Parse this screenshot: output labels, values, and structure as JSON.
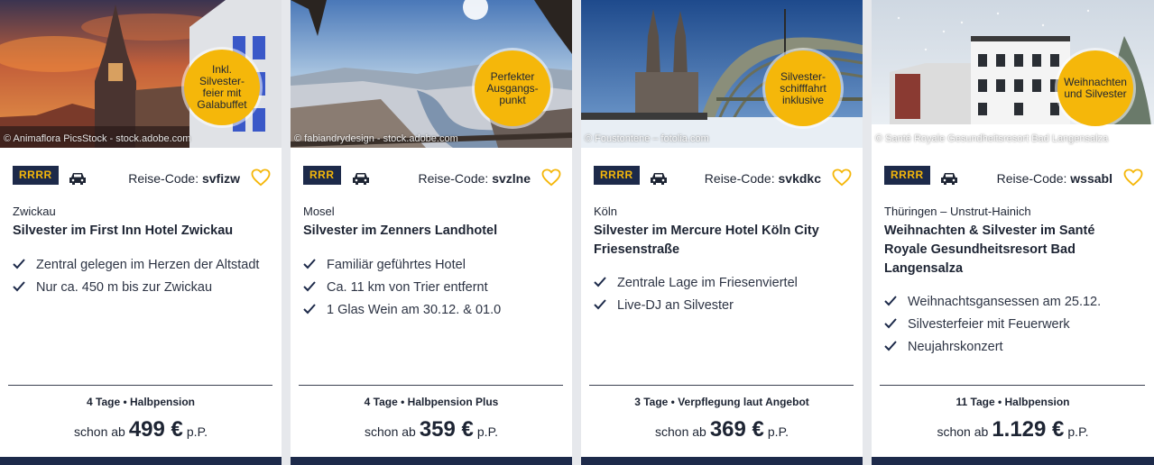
{
  "labels": {
    "code_prefix": "Reise-Code:",
    "price_prefix": "schon ab",
    "price_suffix": "p.P."
  },
  "colors": {
    "navy": "#1d2a4a",
    "accent_yellow": "#f5b70a"
  },
  "cards": [
    {
      "image_credit": "© Animaflora PicsStock - stock.adobe.com",
      "badge": "Inkl. Silvester-feier mit Galabuffet",
      "category": "RRRR",
      "transport_icon": "car-icon",
      "code": "svfizw",
      "region": "Zwickau",
      "title": "Silvester im First Inn Hotel Zwickau",
      "features": [
        "Zentral gelegen im Herzen der Altstadt",
        "Nur ca. 450 m bis zur Zwickau"
      ],
      "duration": "4 Tage • Halbpension",
      "price": "499 €"
    },
    {
      "image_credit": "© fabiandrydesign - stock.adobe.com",
      "badge": "Perfekter Ausgangs-punkt",
      "category": "RRR",
      "transport_icon": "car-icon",
      "code": "svzlne",
      "region": "Mosel",
      "title": "Silvester im Zenners Landhotel",
      "features": [
        "Familiär geführtes Hotel",
        "Ca. 11 km von Trier entfernt",
        "1 Glas Wein am 30.12. & 01.0"
      ],
      "duration": "4 Tage • Halbpension Plus",
      "price": "359 €"
    },
    {
      "image_credit": "© Foustontene – fotolia.com",
      "badge": "Silvester-schifffahrt inklusive",
      "category": "RRRR",
      "transport_icon": "car-icon",
      "code": "svkdkc",
      "region": "Köln",
      "title": "Silvester im Mercure Hotel Köln City Friesenstraße",
      "features": [
        "Zentrale Lage im Friesenviertel",
        "Live-DJ an Silvester"
      ],
      "duration": "3 Tage • Verpflegung laut Angebot",
      "price": "369 €"
    },
    {
      "image_credit": "© Santé Royale Gesundheitsresort Bad Langensalza",
      "badge": "Weihnachten und Silvester",
      "category": "RRRR",
      "transport_icon": "car-icon",
      "code": "wssabl",
      "region": "Thüringen – Unstrut-Hainich",
      "title": "Weihnachten & Silvester im Santé Royale Gesundheitsresort Bad Langensalza",
      "features": [
        "Weihnachtsgansessen am 25.12.",
        "Silvesterfeier mit Feuerwerk",
        "Neujahrskonzert"
      ],
      "duration": "11 Tage • Halbpension",
      "price": "1.129 €"
    }
  ]
}
